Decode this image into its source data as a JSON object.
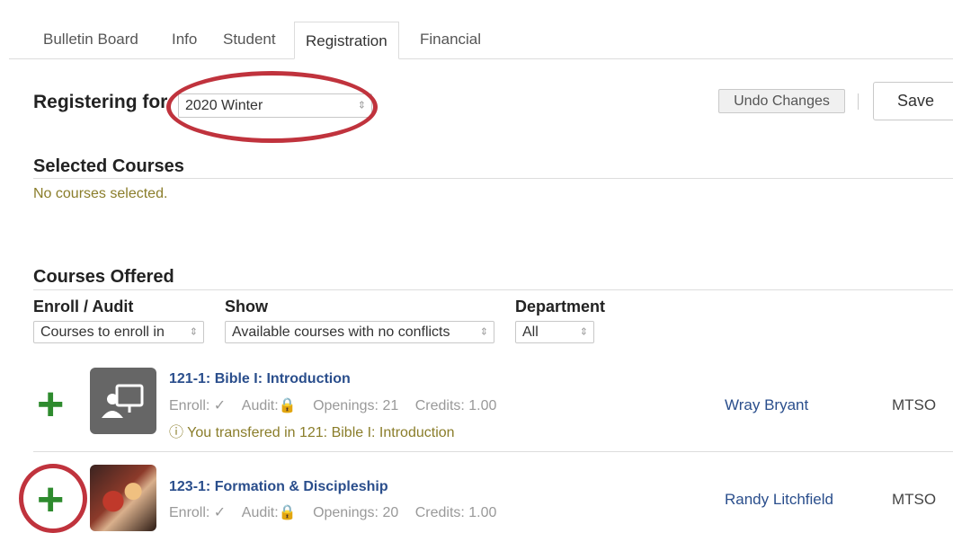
{
  "tabs": [
    {
      "label": "Bulletin Board"
    },
    {
      "label": "Info"
    },
    {
      "label": "Student"
    },
    {
      "label": "Registration",
      "active": true
    },
    {
      "label": "Financial"
    }
  ],
  "registration": {
    "heading": "Registering for",
    "term": "2020 Winter",
    "undo_label": "Undo Changes",
    "save_label": "Save"
  },
  "selected": {
    "heading": "Selected Courses",
    "empty_text": "No courses selected."
  },
  "offered": {
    "heading": "Courses Offered",
    "filters": {
      "enroll_label": "Enroll / Audit",
      "enroll_value": "Courses to enroll in",
      "show_label": "Show",
      "show_value": "Available courses with no conflicts",
      "dept_label": "Department",
      "dept_value": "All"
    },
    "courses": [
      {
        "title": "121-1: Bible I: Introduction",
        "enroll": "Enroll: ✓",
        "audit": "Audit:",
        "openings": "Openings: 21",
        "credits": "Credits: 1.00",
        "note": "ⓘ You transfered in 121: Bible I: Introduction",
        "instructor": "Wray Bryant",
        "campus": "MTSO",
        "thumb_icon": "classroom-icon"
      },
      {
        "title": "123-1: Formation & Discipleship",
        "enroll": "Enroll: ✓",
        "audit": "Audit:",
        "openings": "Openings: 20",
        "credits": "Credits: 1.00",
        "instructor": "Randy Litchfield",
        "campus": "MTSO",
        "thumb_icon": "course-photo"
      }
    ]
  },
  "colors": {
    "link": "#2a4e8c",
    "add": "#2e8b2e",
    "annotation": "#c0333d",
    "notice": "#8a7d2a"
  }
}
